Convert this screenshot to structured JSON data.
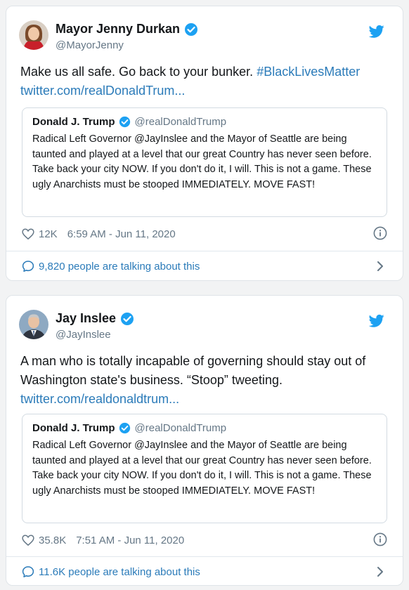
{
  "tweets": [
    {
      "author_name": "Mayor Jenny Durkan",
      "author_handle": "@MayorJenny",
      "text_plain": "Make us all safe. Go back to your bunker. ",
      "hashtag": "#BlackLivesMatter",
      "link": "twitter.com/realDonaldTrum...",
      "quoted": {
        "name": "Donald J. Trump",
        "handle": "@realDonaldTrump",
        "text": "Radical Left Governor @JayInslee and the Mayor of Seattle are being taunted and played at a level that our great Country has never seen before. Take back your city NOW. If you don't do it, I will. This is not a game. These ugly Anarchists must be stooped IMMEDIATELY. MOVE FAST!"
      },
      "likes": "12K",
      "timestamp": "6:59 AM - Jun 11, 2020",
      "talking": "9,820 people are talking about this"
    },
    {
      "author_name": "Jay Inslee",
      "author_handle": "@JayInslee",
      "text_plain": "A man who is totally incapable of governing should stay out of Washington state's business. “Stoop” tweeting.",
      "link": "twitter.com/realdonaldtrum...",
      "quoted": {
        "name": "Donald J. Trump",
        "handle": "@realDonaldTrump",
        "text": "Radical Left Governor @JayInslee and the Mayor of Seattle are being taunted and played at a level that our great Country has never seen before. Take back your city NOW. If you don't do it, I will. This is not a game. These ugly Anarchists must be stooped IMMEDIATELY. MOVE FAST!"
      },
      "likes": "35.8K",
      "timestamp": "7:51 AM - Jun 11, 2020",
      "talking": "11.6K people are talking about this"
    }
  ],
  "icons": {
    "verified": "verified-badge-icon",
    "bird": "twitter-bird-icon",
    "heart": "heart-icon",
    "info": "info-icon",
    "bubble": "speech-bubble-icon",
    "chevron": "chevron-right-icon"
  },
  "colors": {
    "accent": "#1da1f2",
    "link": "#2b7bb9",
    "muted": "#657786",
    "text": "#14171a"
  }
}
